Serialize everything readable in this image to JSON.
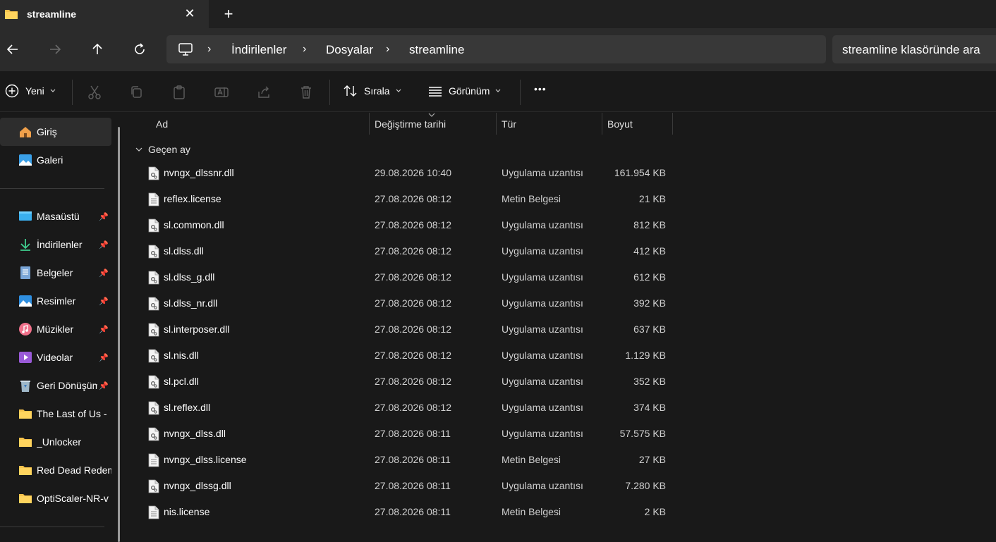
{
  "tab": {
    "title": "streamline",
    "close": "✕",
    "new": "+"
  },
  "breadcrumb": [
    "İndirilenler",
    "Dosyalar",
    "streamline"
  ],
  "search": {
    "placeholder": "streamline klasöründe ara"
  },
  "toolbar": {
    "new_label": "Yeni",
    "sort_label": "Sırala",
    "view_label": "Görünüm",
    "more_label": "•••"
  },
  "sidebar": {
    "top": [
      {
        "label": "Giriş",
        "icon": "home-icon"
      },
      {
        "label": "Galeri",
        "icon": "gallery-icon"
      }
    ],
    "pinned": [
      {
        "label": "Masaüstü",
        "icon": "desktop-icon"
      },
      {
        "label": "İndirilenler",
        "icon": "download-icon"
      },
      {
        "label": "Belgeler",
        "icon": "documents-icon"
      },
      {
        "label": "Resimler",
        "icon": "pictures-icon"
      },
      {
        "label": "Müzikler",
        "icon": "music-icon"
      },
      {
        "label": "Videolar",
        "icon": "videos-icon"
      },
      {
        "label": "Geri Dönüşüm Kutusu",
        "icon": "recycle-bin-icon"
      }
    ],
    "folders": [
      {
        "label": "The Last of Us - ",
        "icon": "folder-icon"
      },
      {
        "label": "_Unlocker",
        "icon": "folder-icon"
      },
      {
        "label": "Red Dead Redemption",
        "icon": "folder-icon"
      },
      {
        "label": "OptiScaler-NR-v",
        "icon": "folder-icon"
      }
    ]
  },
  "columns": {
    "name": "Ad",
    "modified": "Değiştirme tarihi",
    "type": "Tür",
    "size": "Boyut"
  },
  "group_label": "Geçen ay",
  "files": [
    {
      "name": "nvngx_dlssnr.dll",
      "modified": "29.08.2026 10:40",
      "type": "Uygulama uzantısı",
      "size": "161.954 KB",
      "kind": "dll"
    },
    {
      "name": "reflex.license",
      "modified": "27.08.2026 08:12",
      "type": "Metin Belgesi",
      "size": "21 KB",
      "kind": "text"
    },
    {
      "name": "sl.common.dll",
      "modified": "27.08.2026 08:12",
      "type": "Uygulama uzantısı",
      "size": "812 KB",
      "kind": "dll"
    },
    {
      "name": "sl.dlss.dll",
      "modified": "27.08.2026 08:12",
      "type": "Uygulama uzantısı",
      "size": "412 KB",
      "kind": "dll"
    },
    {
      "name": "sl.dlss_g.dll",
      "modified": "27.08.2026 08:12",
      "type": "Uygulama uzantısı",
      "size": "612 KB",
      "kind": "dll"
    },
    {
      "name": "sl.dlss_nr.dll",
      "modified": "27.08.2026 08:12",
      "type": "Uygulama uzantısı",
      "size": "392 KB",
      "kind": "dll"
    },
    {
      "name": "sl.interposer.dll",
      "modified": "27.08.2026 08:12",
      "type": "Uygulama uzantısı",
      "size": "637 KB",
      "kind": "dll"
    },
    {
      "name": "sl.nis.dll",
      "modified": "27.08.2026 08:12",
      "type": "Uygulama uzantısı",
      "size": "1.129 KB",
      "kind": "dll"
    },
    {
      "name": "sl.pcl.dll",
      "modified": "27.08.2026 08:12",
      "type": "Uygulama uzantısı",
      "size": "352 KB",
      "kind": "dll"
    },
    {
      "name": "sl.reflex.dll",
      "modified": "27.08.2026 08:12",
      "type": "Uygulama uzantısı",
      "size": "374 KB",
      "kind": "dll"
    },
    {
      "name": "nvngx_dlss.dll",
      "modified": "27.08.2026 08:11",
      "type": "Uygulama uzantısı",
      "size": "57.575 KB",
      "kind": "dll"
    },
    {
      "name": "nvngx_dlss.license",
      "modified": "27.08.2026 08:11",
      "type": "Metin Belgesi",
      "size": "27 KB",
      "kind": "text"
    },
    {
      "name": "nvngx_dlssg.dll",
      "modified": "27.08.2026 08:11",
      "type": "Uygulama uzantısı",
      "size": "7.280 KB",
      "kind": "dll"
    },
    {
      "name": "nis.license",
      "modified": "27.08.2026 08:11",
      "type": "Metin Belgesi",
      "size": "2 KB",
      "kind": "text"
    }
  ],
  "colors": {
    "folder": "#f5c24c",
    "accent": "#4cc2ff",
    "selected": "#2d2d2d"
  }
}
